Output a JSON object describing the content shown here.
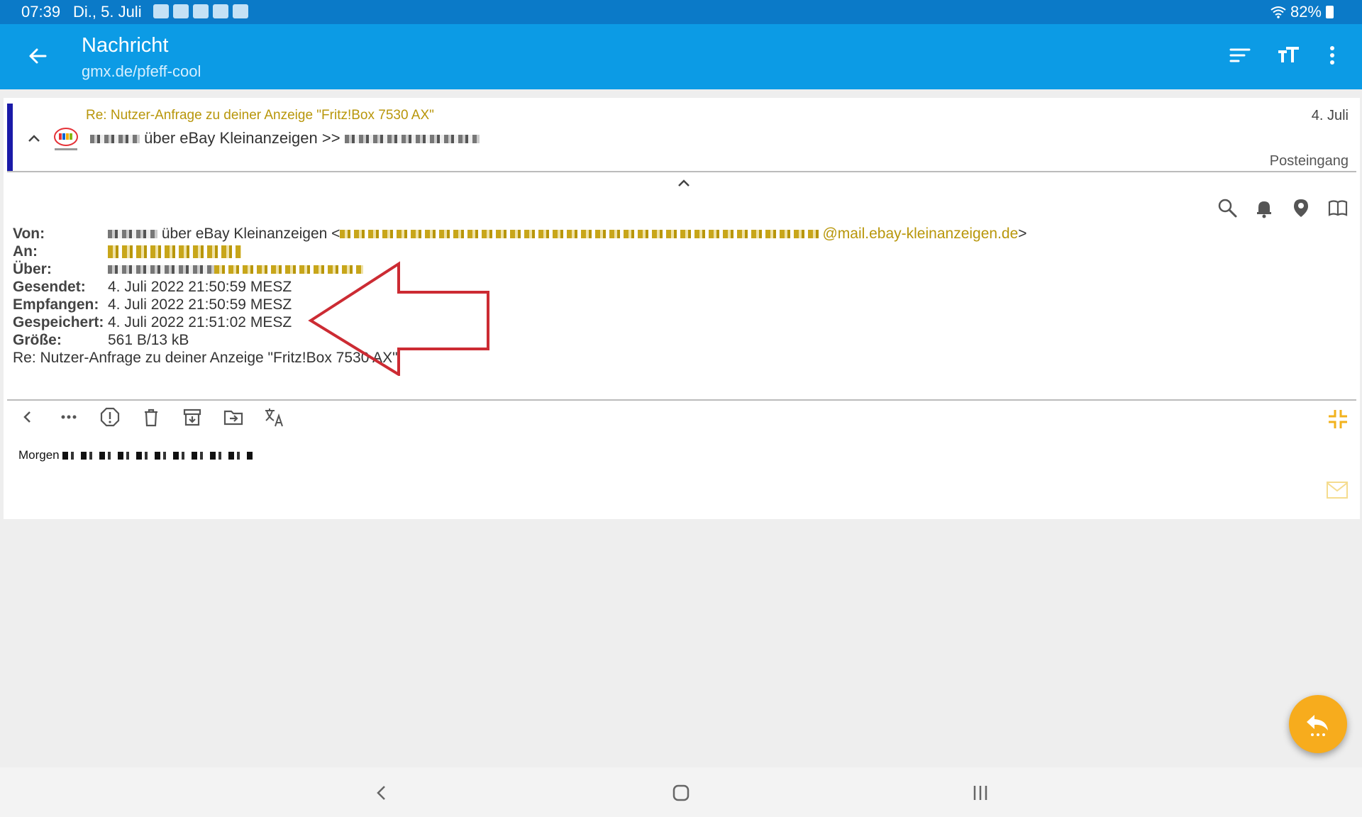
{
  "status_bar": {
    "time": "07:39",
    "date": "Di., 5. Juli",
    "battery": "82%"
  },
  "app_bar": {
    "title": "Nachricht",
    "subtitle": "gmx.de/pfeff-cool"
  },
  "message": {
    "subject": "Re: Nutzer-Anfrage zu deiner Anzeige \"Fritz!Box 7530 AX\"",
    "date": "4. Juli",
    "sender_visible": "über eBay Kleinanzeigen >>",
    "folder": "Posteingang"
  },
  "headers": {
    "from_label": "Von:",
    "from_value": "über eBay Kleinanzeigen <",
    "from_email_tail": "@mail.ebay-kleinanzeigen.de",
    "from_close": ">",
    "to_label": "An:",
    "via_label": "Über:",
    "sent_label": "Gesendet:",
    "sent_value": "4. Juli 2022 21:50:59 MESZ",
    "received_label": "Empfangen:",
    "received_value": "4. Juli 2022 21:50:59 MESZ",
    "saved_label": "Gespeichert:",
    "saved_value": "4. Juli 2022 21:51:02 MESZ",
    "size_label": "Größe:",
    "size_value": "561 B/13 kB",
    "subject_line": "Re: Nutzer-Anfrage zu deiner Anzeige \"Fritz!Box 7530 AX\""
  },
  "body": {
    "greeting": "Morgen"
  },
  "colors": {
    "status_bar": "#0b7ac8",
    "app_bar": "#0c9be5",
    "accent_bar": "#1a1aa8",
    "email_gold": "#b8960a",
    "fab": "#f7ac1d",
    "annotation_arrow": "#cc2b33"
  }
}
